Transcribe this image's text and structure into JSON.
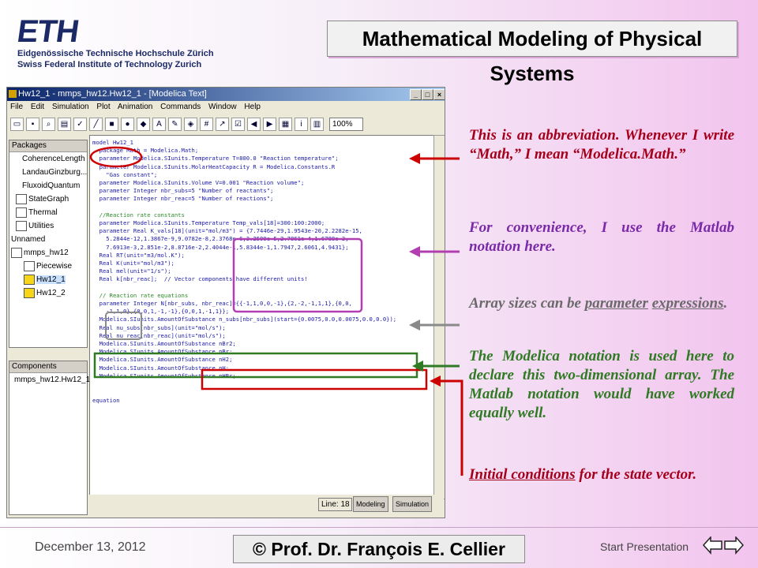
{
  "header": {
    "logo_text": "ETH",
    "logo_line1": "Eidgenössische Technische Hochschule Zürich",
    "logo_line2": "Swiss Federal Institute of Technology Zurich",
    "title": "Mathematical Modeling of Physical Systems"
  },
  "window": {
    "title": "Hw12_1 - mmps_hw12.Hw12_1 - [Modelica Text]",
    "menu": [
      "File",
      "Edit",
      "Simulation",
      "Plot",
      "Animation",
      "Commands",
      "Window",
      "Help"
    ],
    "zoom": "100%",
    "packages_title": "Packages",
    "packages_items": [
      {
        "label": "CoherenceLength"
      },
      {
        "label": "LandauGinzburg..."
      },
      {
        "label": "FluxoidQuantum"
      },
      {
        "label": "StateGraph"
      },
      {
        "label": "Thermal"
      },
      {
        "label": "Utilities"
      },
      {
        "label": "Unnamed"
      },
      {
        "label": "mmps_hw12"
      },
      {
        "label": "Piecewise"
      },
      {
        "label": "Hw12_1"
      },
      {
        "label": "Hw12_2"
      }
    ],
    "components_title": "Components",
    "components_item": "mmps_hw12.Hw12_1",
    "code": [
      "model Hw12_1",
      "  package Math = Modelica.Math;",
      "  parameter Modelica.SIunits.Temperature T=800.0 \"Reaction temperature\";",
      "  parameter Modelica.SIunits.MolarHeatCapacity R = Modelica.Constants.R",
      "    \"Gas constant\";",
      "  parameter Modelica.SIunits.Volume V=0.001 \"Reaction volume\";",
      "  parameter Integer nbr_subs=5 \"Number of reactants\";",
      "  parameter Integer nbr_reac=5 \"Number of reactions\";",
      "",
      "  //Reaction rate constants",
      "  parameter Modelica.SIunits.Temperature Temp_vals[18]=300:100:2000;",
      "  parameter Real K_vals[18](unit=\"mol/m3\") = {7.7446e-29,1.9543e-20,2.2282e-15,",
      "    5.2844e-12,1.3867e-9,9.0782e-8,2.3768e-6,3.2509e-5,2.7861e-4,1.6788e-3,",
      "    7.6913e-3,2.851e-2,8.8716e-2,2.4044e-1,5.8344e-1,1.7947,2.6061,4.9431};",
      "  Real RT(unit=\"m3/mol.K\");",
      "  Real K(unit=\"mol/m3\");",
      "  Real mel(unit=\"1/s\");",
      "  Real k[nbr_reac];  // Vector components have different units!",
      "",
      "  // Reaction rate equations",
      "  parameter Integer N[nbr_subs, nbr_reac]={{-1,1,0,0,-1},{2,-2,-1,1,1},{0,0,",
      "    -1,1,0},{0,0,1,-1,-1},{0,0,1,-1,1}};",
      "  Modelica.SIunits.AmountOfSubstance n_subs[nbr_subs](start={0.0075,0.0,0.0075,0.0,0.0});",
      "  Real nu_subs[nbr_subs](unit=\"mol/s\");",
      "  Real nu_reac[nbr_reac](unit=\"mol/s\");",
      "  Modelica.SIunits.AmountOfSubstance nBr2;",
      "  Modelica.SIunits.AmountOfSubstance nBr;",
      "  Modelica.SIunits.AmountOfSubstance nH2;",
      "  Modelica.SIunits.AmountOfSubstance nH;",
      "  Modelica.SIunits.AmountOfSubstance nHBr;",
      "",
      "",
      "equation"
    ],
    "status_line": "Line:  18",
    "tab_modeling": "Modeling",
    "tab_simulation": "Simulation"
  },
  "annotations": {
    "a1": "This is an abbreviation. Whenever I write “Math,” I mean “Modelica.Math.”",
    "a2": "For convenience, I use the Matlab notation here.",
    "a3_prefix": "Array sizes can be ",
    "a3_u1": "parameter",
    "a3_u2": "expressions",
    "a3_suffix": ".",
    "a4": "The Modelica notation is used here to declare this two-dimensional array. The Matlab notation would have worked equally well.",
    "a5_u": "Initial conditions",
    "a5_rest": " for the state vector."
  },
  "footer": {
    "date": "December 13, 2012",
    "author": "© Prof. Dr. François E. Cellier",
    "start": "Start Presentation"
  },
  "colors": {
    "red": "#a5001b",
    "purple": "#7a2aa8",
    "grey": "#6a6a6a",
    "green": "#2f7a23"
  }
}
